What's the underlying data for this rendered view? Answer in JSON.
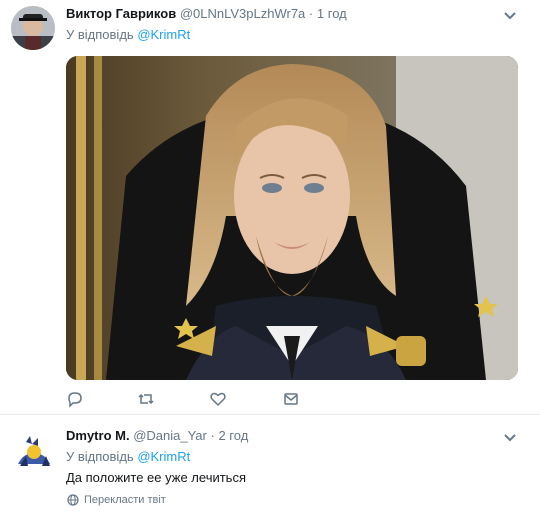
{
  "tweets": [
    {
      "author_name": "Виктор Гавриков",
      "handle": "@0LNnLV3pLzhWr7a",
      "dot": "·",
      "time": "1 год",
      "reply_prefix": "У відповідь",
      "reply_handle": "@KrimRt",
      "actions": {
        "reply_icon": "reply-icon",
        "retweet_icon": "retweet-icon",
        "like_icon": "heart-icon",
        "dm_icon": "envelope-icon"
      }
    },
    {
      "author_name": "Dmytro M.",
      "handle": "@Dania_Yar",
      "dot": "·",
      "time": "2 год",
      "reply_prefix": "У відповідь",
      "reply_handle": "@KrimRt",
      "text": "Да положите ее уже лечиться",
      "translate_label": "Перекласти твіт"
    }
  ],
  "colors": {
    "link": "#1da1f2",
    "secondary": "#657786",
    "text": "#14171a",
    "divider": "#e6ecf0"
  }
}
